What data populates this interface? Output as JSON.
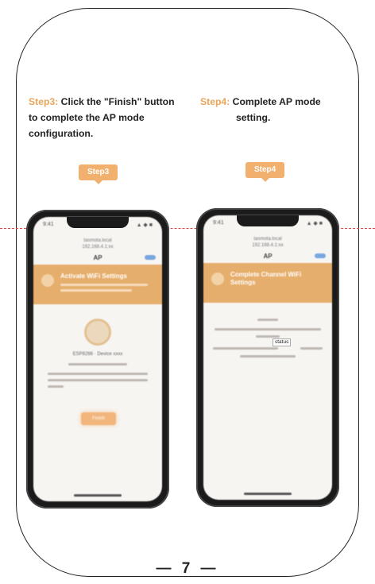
{
  "step3": {
    "label": "Step3:",
    "text_line1": " Click the \"Finish\" button",
    "text_line2": "to complete the AP mode",
    "text_line3": "configuration.",
    "badge": "Step3",
    "phone": {
      "status_time": "9:41",
      "status_icons": "▲ ◆ ■",
      "url_line1": "tasmota.local",
      "url_line2": "192.168.4.1:xx",
      "nav_title": "AP",
      "header_title": "Activate WiFi Settings",
      "device_line": "ESP8266 · Device xxxx",
      "finish_label": "Finish"
    }
  },
  "step4": {
    "label": "Step4:",
    "text_line1": " Complete AP mode",
    "text_line2": "setting.",
    "badge": "Step4",
    "phone": {
      "status_time": "9:41",
      "status_icons": "▲ ◆ ■",
      "url_line1": "tasmota.local",
      "url_line2": "192.168.4.1:xx",
      "nav_title": "AP",
      "header_title": "Complete Channel WiFi Settings",
      "status_tag": "status"
    }
  },
  "page_number": "— 7 —",
  "colors": {
    "accent": "#e8a559",
    "badge": "#f1b06e",
    "cut_line": "#d84a4a"
  }
}
